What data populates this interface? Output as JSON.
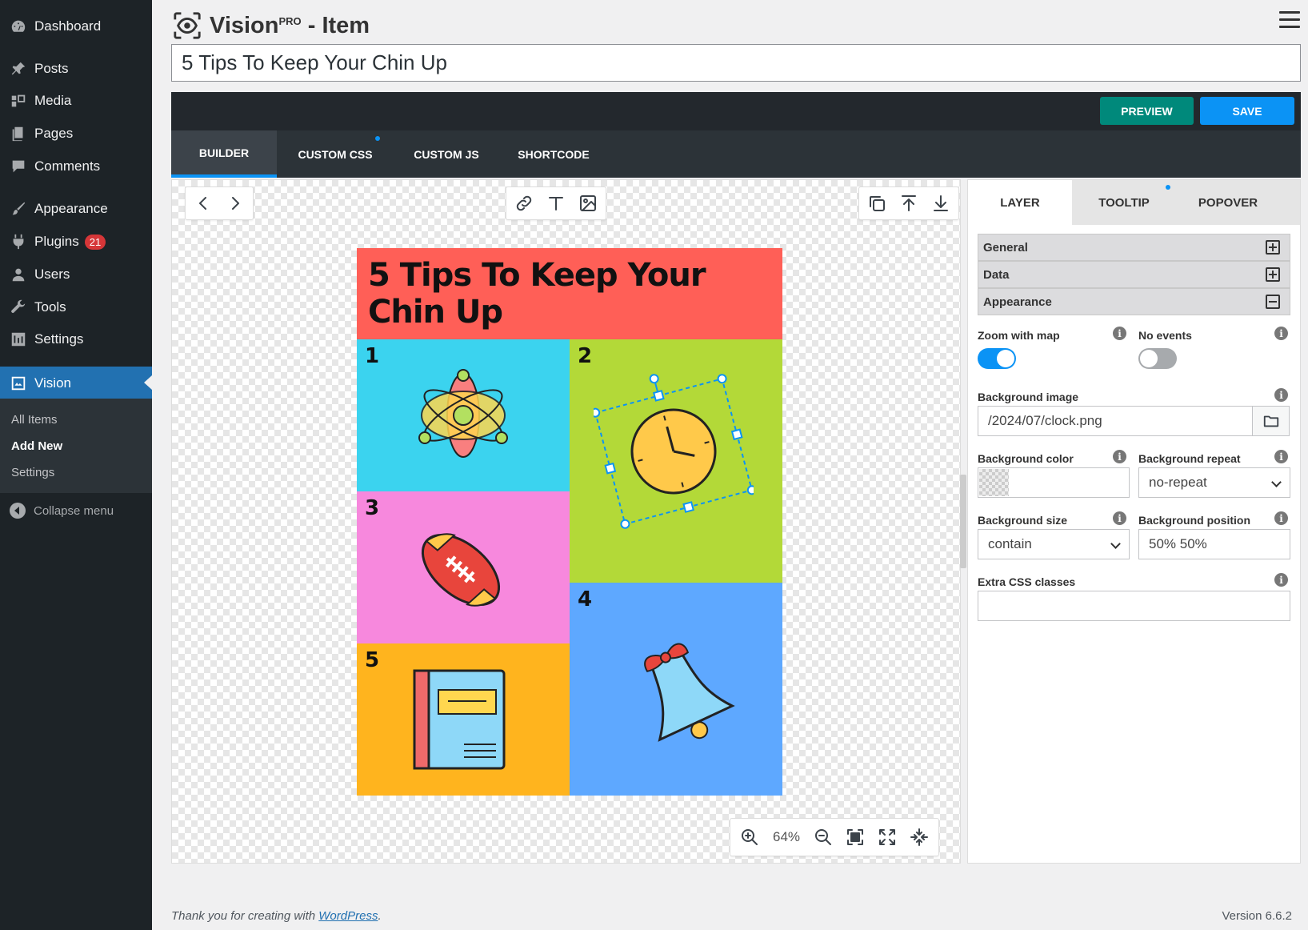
{
  "sidebar": {
    "items": [
      {
        "label": "Dashboard",
        "icon": "dashboard-icon"
      },
      {
        "label": "Posts",
        "icon": "pin-icon"
      },
      {
        "label": "Media",
        "icon": "media-icon"
      },
      {
        "label": "Pages",
        "icon": "pages-icon"
      },
      {
        "label": "Comments",
        "icon": "comment-icon"
      },
      {
        "label": "Appearance",
        "icon": "brush-icon"
      },
      {
        "label": "Plugins",
        "icon": "plugin-icon",
        "badge": "21"
      },
      {
        "label": "Users",
        "icon": "user-icon"
      },
      {
        "label": "Tools",
        "icon": "wrench-icon"
      },
      {
        "label": "Settings",
        "icon": "settings-icon"
      },
      {
        "label": "Vision",
        "icon": "vision-icon",
        "active": true
      }
    ],
    "submenu": [
      "All Items",
      "Add New",
      "Settings"
    ],
    "collapse_label": "Collapse menu"
  },
  "header": {
    "app_name": "Vision",
    "app_sup": "PRO",
    "app_suffix": " - Item",
    "title_value": "5 Tips To Keep Your Chin Up"
  },
  "toolbar": {
    "preview_label": "PREVIEW",
    "save_label": "SAVE"
  },
  "tabs": [
    "BUILDER",
    "CUSTOM CSS",
    "CUSTOM JS",
    "SHORTCODE"
  ],
  "canvas": {
    "zoom": "64%",
    "infographic": {
      "title": "5 Tips To Keep Your Chin Up",
      "numbers": [
        "1",
        "2",
        "3",
        "4",
        "5"
      ]
    }
  },
  "panel": {
    "tabs": [
      "LAYER",
      "TOOLTIP",
      "POPOVER"
    ],
    "sections": [
      "General",
      "Data",
      "Appearance"
    ],
    "zoom_with_map_label": "Zoom with map",
    "zoom_with_map": true,
    "no_events_label": "No events",
    "no_events": false,
    "bg_image_label": "Background image",
    "bg_image_value": "/2024/07/clock.png",
    "bg_color_label": "Background color",
    "bg_color_value": "",
    "bg_repeat_label": "Background repeat",
    "bg_repeat_value": "no-repeat",
    "bg_size_label": "Background size",
    "bg_size_value": "contain",
    "bg_position_label": "Background position",
    "bg_position_value": "50% 50%",
    "extra_css_label": "Extra CSS classes",
    "extra_css_value": "",
    "info_glyph": "i"
  },
  "footer": {
    "thanks_prefix": "Thank you for creating with ",
    "thanks_link": "WordPress",
    "thanks_suffix": ".",
    "version": "Version 6.6.2"
  },
  "colors": {
    "sidebar_bg": "#1d2327",
    "accent": "#2271b1",
    "preview": "#00897b",
    "save": "#0b93f5",
    "ig_red": "#ff5f57",
    "ig_cyan": "#3bd3ef",
    "ig_green": "#b3d938",
    "ig_pink": "#f788dd",
    "ig_blue": "#5ea8ff",
    "ig_orange": "#ffb41e"
  }
}
